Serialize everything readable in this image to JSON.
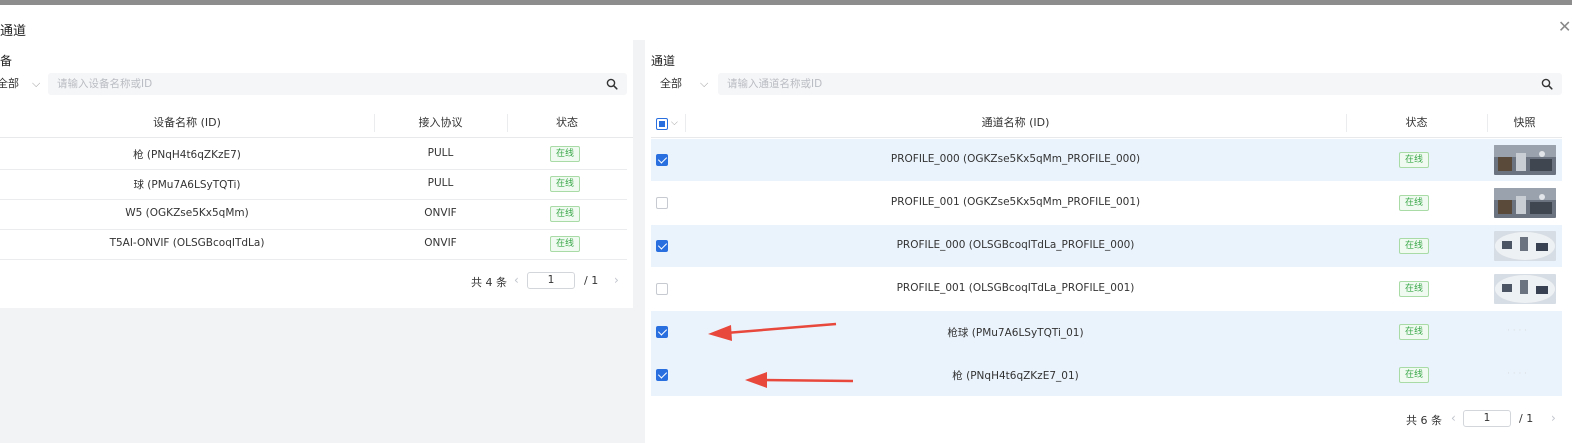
{
  "dialog": {
    "title": "通道",
    "close_icon": "close-icon"
  },
  "left": {
    "title": "备",
    "filter": "全部",
    "search_placeholder": "请输入设备名称或ID",
    "columns": [
      "设备名称 (ID)",
      "接入协议",
      "状态"
    ],
    "rows": [
      {
        "name": "枪 (PNqH4t6qZKzE7)",
        "protocol": "PULL",
        "status": "在线"
      },
      {
        "name": "球 (PMu7A6LSyTQTi)",
        "protocol": "PULL",
        "status": "在线"
      },
      {
        "name": "W5 (OGKZse5Kx5qMm)",
        "protocol": "ONVIF",
        "status": "在线"
      },
      {
        "name": "T5AI-ONVIF (OLSGBcoqITdLa)",
        "protocol": "ONVIF",
        "status": "在线"
      }
    ],
    "pager": {
      "total": "共 4 条",
      "page": "1",
      "of": "/  1"
    }
  },
  "right": {
    "title": "通道",
    "filter": "全部",
    "search_placeholder": "请输入通道名称或ID",
    "columns": [
      "通道名称 (ID)",
      "状态",
      "快照"
    ],
    "rows": [
      {
        "name": "PROFILE_000 (OGKZse5Kx5qMm_PROFILE_000)",
        "status": "在线",
        "checked": true,
        "snapshot": "office"
      },
      {
        "name": "PROFILE_001 (OGKZse5Kx5qMm_PROFILE_001)",
        "status": "在线",
        "checked": false,
        "snapshot": "office"
      },
      {
        "name": "PROFILE_000 (OLSGBcoqITdLa_PROFILE_000)",
        "status": "在线",
        "checked": true,
        "snapshot": "fisheye"
      },
      {
        "name": "PROFILE_001 (OLSGBcoqITdLa_PROFILE_001)",
        "status": "在线",
        "checked": false,
        "snapshot": "fisheye"
      },
      {
        "name": "枪球 (PMu7A6LSyTQTi_01)",
        "status": "在线",
        "checked": true,
        "snapshot": "none"
      },
      {
        "name": "枪 (PNqH4t6qZKzE7_01)",
        "status": "在线",
        "checked": true,
        "snapshot": "none"
      }
    ],
    "pager": {
      "total": "共 6 条",
      "page": "1",
      "of": "/  1"
    }
  },
  "colors": {
    "accent": "#2a6fe0",
    "online": "#3aa84a",
    "selected_row": "#eaf3fc",
    "annotation_arrow": "#e8473b"
  }
}
